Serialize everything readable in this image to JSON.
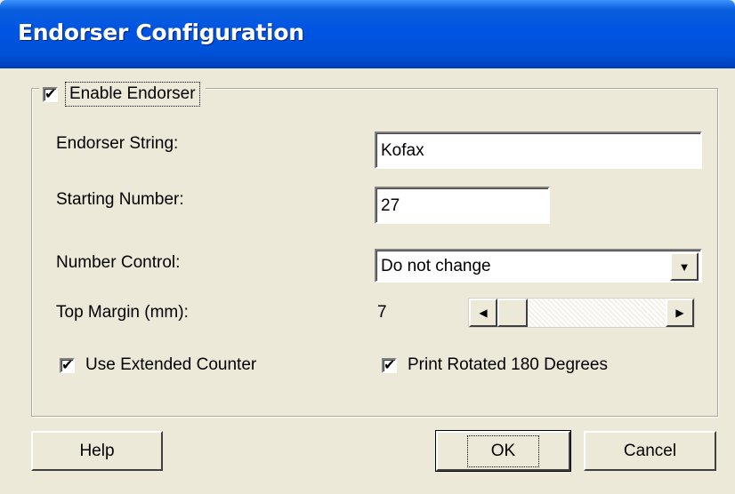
{
  "window": {
    "title": "Endorser Configuration"
  },
  "group": {
    "enable_label": "Enable Endorser",
    "enable_checked": true
  },
  "fields": {
    "endorser_string_label": "Endorser String:",
    "endorser_string_value": "Kofax",
    "starting_number_label": "Starting Number:",
    "starting_number_value": "27",
    "number_control_label": "Number Control:",
    "number_control_value": "Do not change",
    "top_margin_label": "Top Margin (mm):",
    "top_margin_value": "7"
  },
  "options": {
    "extended_counter_label": "Use Extended Counter",
    "extended_counter_checked": true,
    "rotated_label": "Print Rotated 180 Degrees",
    "rotated_checked": true
  },
  "buttons": {
    "help": "Help",
    "ok": "OK",
    "cancel": "Cancel"
  },
  "icons": {
    "dropdown": "chevron-down-icon",
    "scroll_left": "arrow-left-icon",
    "scroll_right": "arrow-right-icon"
  }
}
